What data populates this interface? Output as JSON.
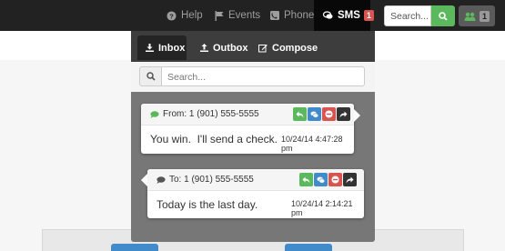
{
  "navbar": {
    "help_label": "Help",
    "events_label": "Events",
    "phone_label": "Phone",
    "sms_label": "SMS",
    "sms_badge": "1",
    "search_placeholder": "Search...",
    "users_badge": "1",
    "icons": {
      "help": "help-icon",
      "events": "flag-icon",
      "phone": "phone-icon",
      "sms": "chat-icon",
      "search": "search-icon",
      "users": "users-icon"
    }
  },
  "sms_panel": {
    "tabs": [
      {
        "label": "Inbox",
        "icon": "download-icon",
        "active": true
      },
      {
        "label": "Outbox",
        "icon": "upload-icon",
        "active": false
      },
      {
        "label": "Compose",
        "icon": "edit-icon",
        "active": false
      }
    ],
    "search_placeholder": "Search...",
    "messages": [
      {
        "direction_label": "From: 1 (901) 555-5555",
        "text": "You win.  I'll send a check.",
        "timestamp": "10/24/14 4:47:28 pm",
        "icon_color": "#5cb85c",
        "actions": [
          "reply-icon",
          "chat-icon",
          "delete-icon",
          "forward-icon"
        ]
      },
      {
        "direction_label": "To: 1 (901) 555-5555",
        "text": "Today is the last day.",
        "timestamp": "10/24/14 2:14:21 pm",
        "icon_color": "#555555",
        "actions": [
          "reply-icon",
          "chat-icon",
          "delete-icon",
          "forward-icon"
        ]
      }
    ]
  },
  "colors": {
    "navbar": "#222222",
    "success": "#5cb85c",
    "primary": "#428bca",
    "danger": "#d9534f",
    "dark": "#333333"
  }
}
